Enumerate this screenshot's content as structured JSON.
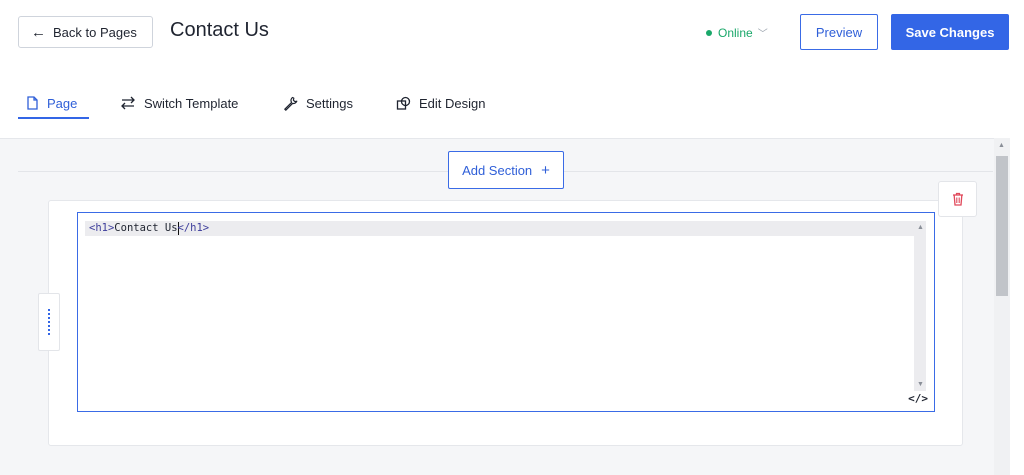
{
  "header": {
    "back_label": "Back to Pages",
    "title": "Contact Us",
    "status_label": "Online",
    "preview_label": "Preview",
    "save_label": "Save Changes"
  },
  "tabs": [
    {
      "label": "Page",
      "icon": "page-icon",
      "active": true
    },
    {
      "label": "Switch Template",
      "icon": "switch-arrows-icon",
      "active": false
    },
    {
      "label": "Settings",
      "icon": "wrench-icon",
      "active": false
    },
    {
      "label": "Edit Design",
      "icon": "edit-design-icon",
      "active": false
    }
  ],
  "canvas": {
    "add_section_label": "Add Section",
    "add_section_plus": "+"
  },
  "editor": {
    "code_open_tag": "<h1>",
    "code_text_before_cursor": "Contact Us",
    "code_text_after_cursor": "",
    "code_close_tag": "</h1>",
    "toggle_label": "</>"
  },
  "colors": {
    "accent": "#3366e6",
    "status_green": "#1aa86a",
    "delete_red": "#e0485a"
  }
}
